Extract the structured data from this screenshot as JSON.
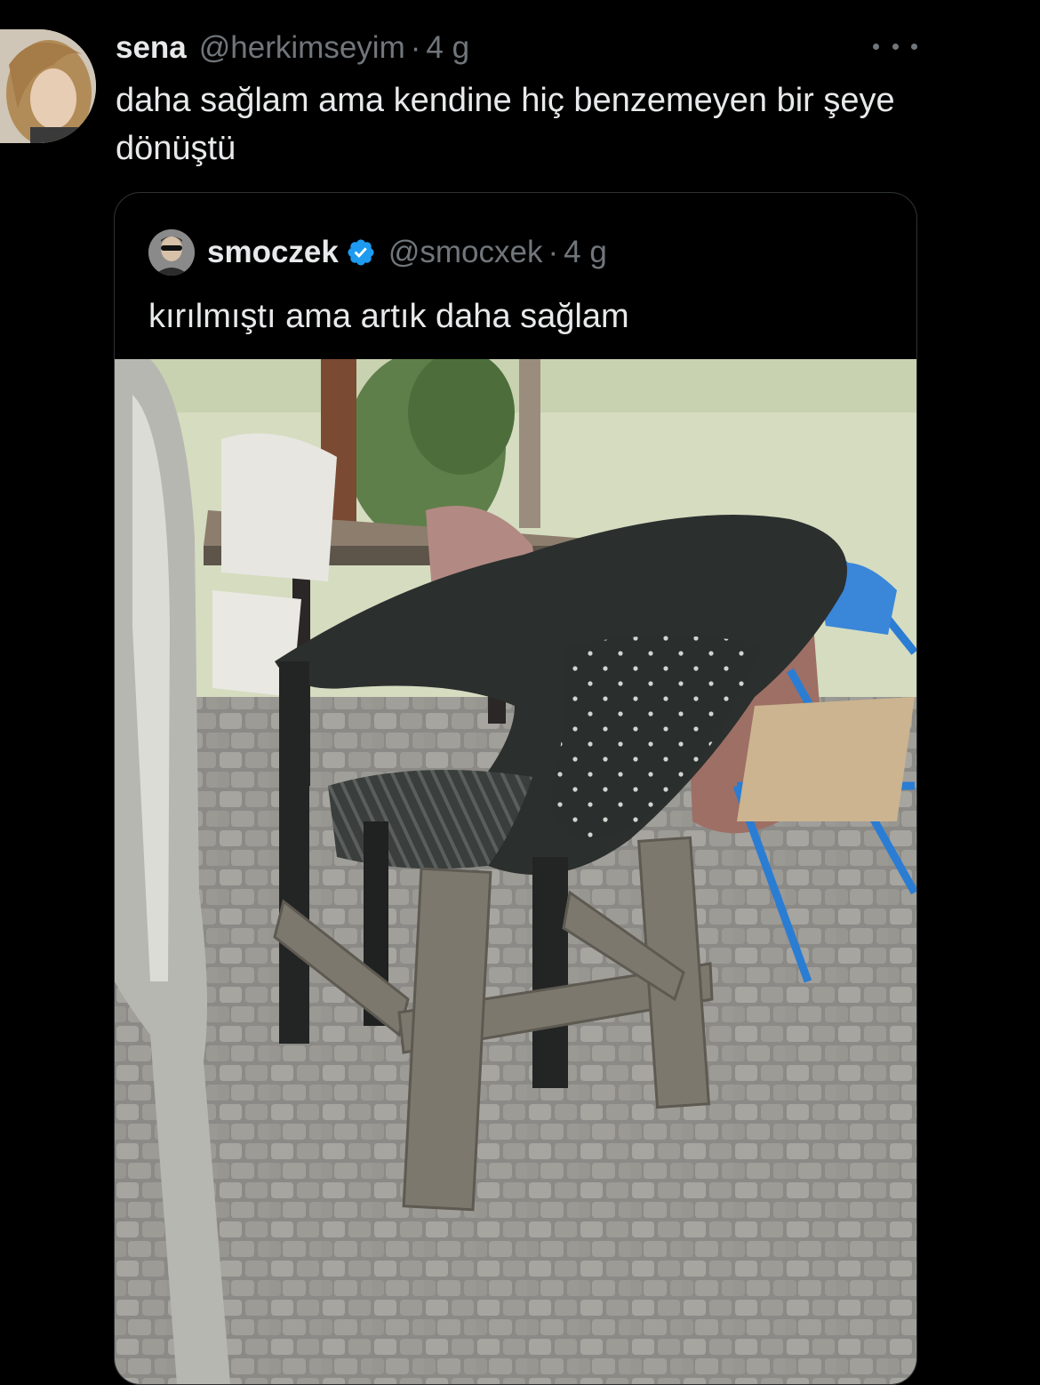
{
  "tweet": {
    "author_name": "sena",
    "author_handle": "@herkimseyim",
    "separator": "·",
    "time": "4 g",
    "text": "daha sağlam ama kendine hiç benzemeyen bir şeye dönüştü",
    "avatar_icon": "profile-photo"
  },
  "quote": {
    "author_name": "smoczek",
    "verified": true,
    "verified_color": "#1d9bf0",
    "author_handle": "@smocxek",
    "separator": "·",
    "time": "4 g",
    "text": "kırılmıştı ama artık daha sağlam",
    "media_icon": "photo-black-plastic-chair-on-wooden-frame"
  },
  "colors": {
    "background": "#000000",
    "primary_text": "#e7e9ea",
    "secondary_text": "#71767b",
    "border": "#2f3336"
  }
}
